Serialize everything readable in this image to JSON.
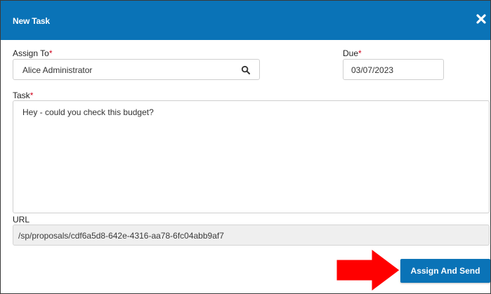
{
  "dialog": {
    "title": "New Task",
    "close_icon": "close-icon"
  },
  "form": {
    "assign_to": {
      "label": "Assign To",
      "required_mark": "*",
      "value": "Alice Administrator",
      "icon": "search-icon"
    },
    "due": {
      "label": "Due",
      "required_mark": "*",
      "value": "03/07/2023"
    },
    "task": {
      "label": "Task",
      "required_mark": "*",
      "value": "Hey - could you check this budget?"
    },
    "url": {
      "label": "URL",
      "value": "/sp/proposals/cdf6a5d8-642e-4316-aa78-6fc04abb9af7"
    }
  },
  "actions": {
    "submit_label": "Assign And Send"
  },
  "annotation": {
    "arrow_color": "#ff0000"
  },
  "colors": {
    "brand": "#0a73b7",
    "required": "#d0021b"
  }
}
